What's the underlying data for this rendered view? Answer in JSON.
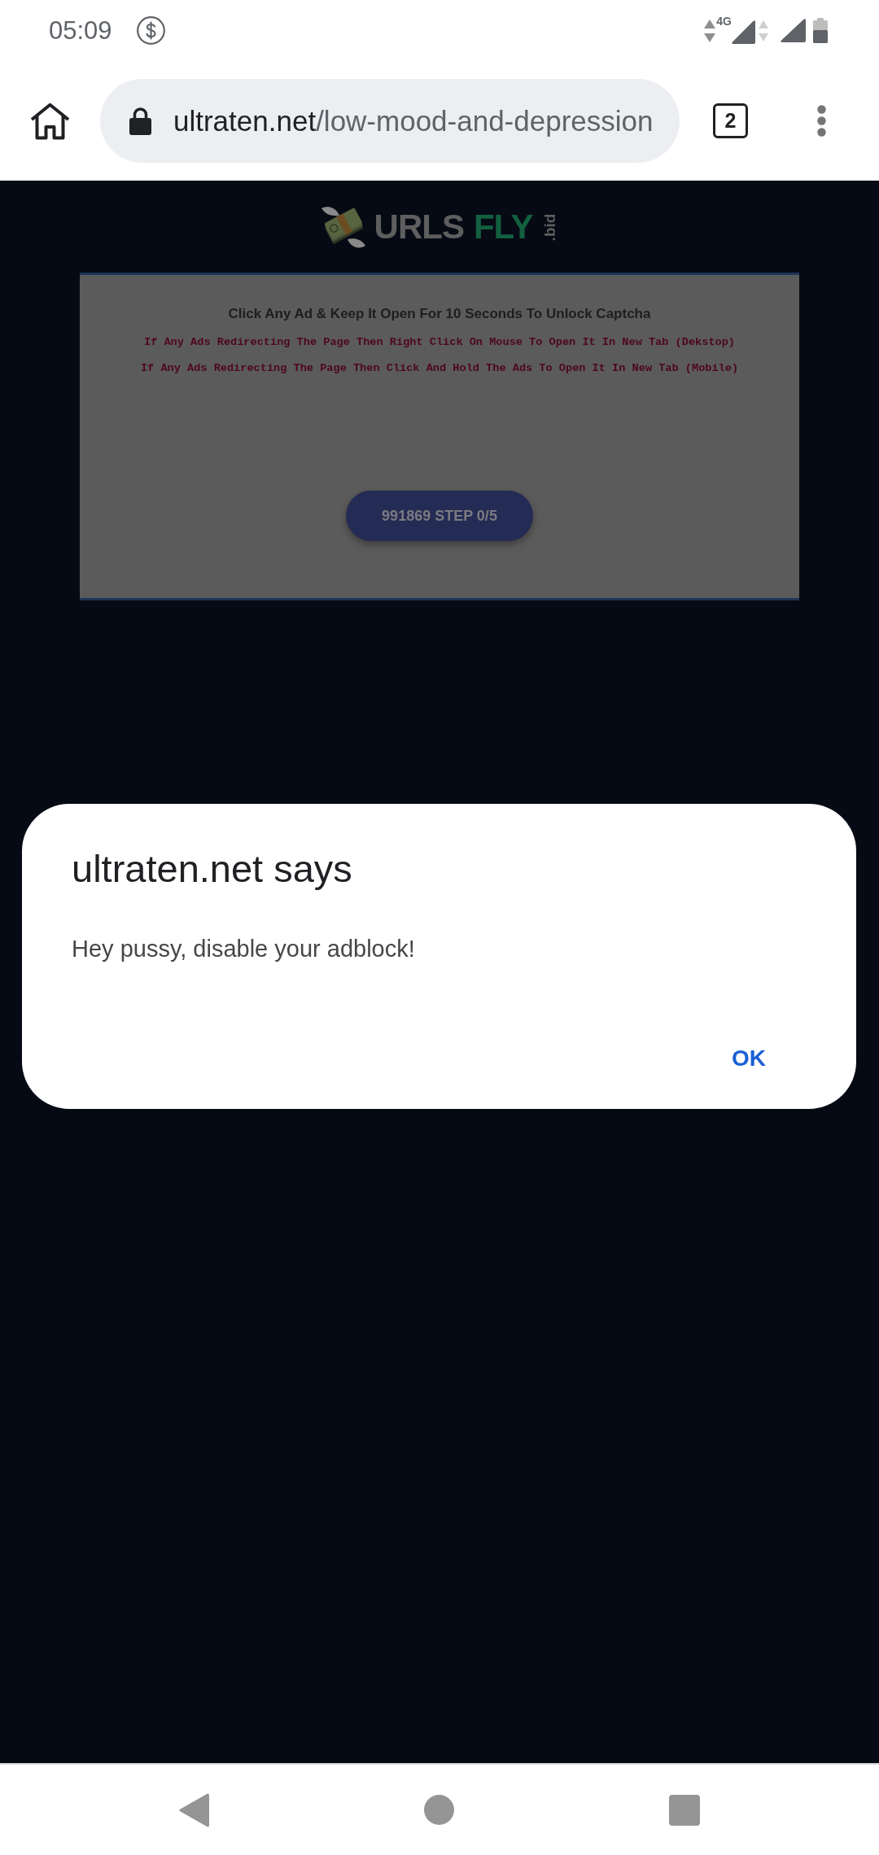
{
  "status_bar": {
    "time": "05:09",
    "network_type": "4G"
  },
  "browser_toolbar": {
    "url_host": "ultraten.net",
    "url_path": "/low-mood-and-depression",
    "tab_count": "2"
  },
  "page": {
    "logo": {
      "text": "URLS",
      "accent": "FLY",
      "suffix": ".bid"
    },
    "card": {
      "title": "Click Any Ad & Keep It Open For 10 Seconds To Unlock Captcha",
      "notes": [
        "If Any Ads Redirecting The Page Then Right Click On Mouse To Open It In New Tab (Dekstop)",
        "If Any Ads Redirecting The Page Then Click And Hold The Ads To Open It In New Tab (Mobile)"
      ],
      "button": "991869 STEP 0/5"
    }
  },
  "dialog": {
    "title": "ultraten.net says",
    "message": "Hey pussy, disable your adblock!",
    "buttons": [
      "OK"
    ]
  }
}
